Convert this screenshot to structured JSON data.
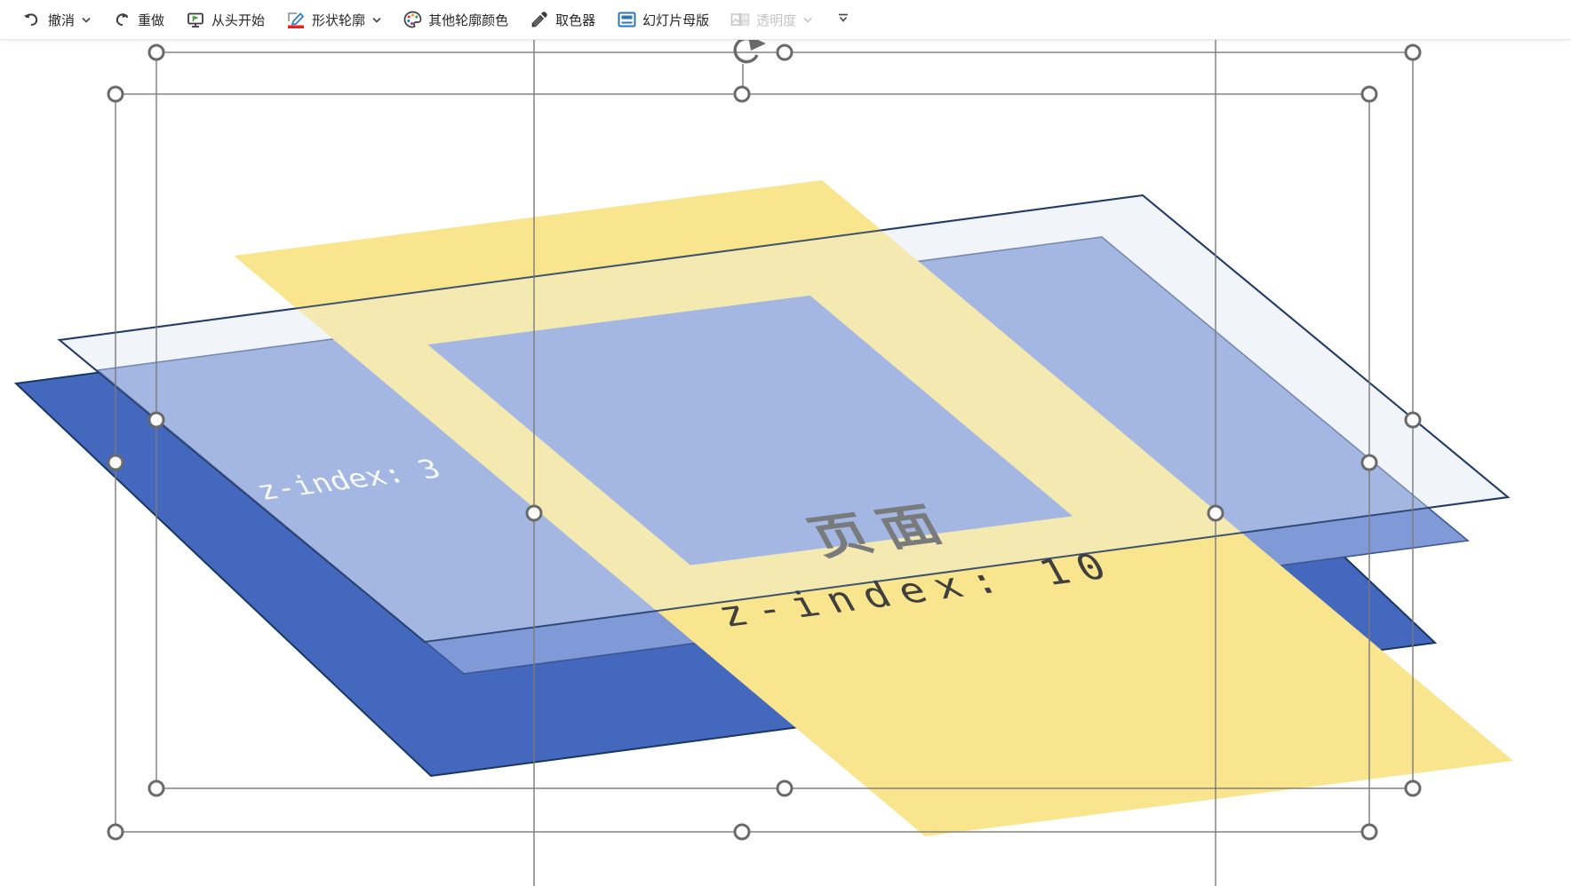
{
  "toolbar": {
    "items": [
      {
        "id": "undo",
        "label": "撤消",
        "dropdown": true
      },
      {
        "id": "redo",
        "label": "重做",
        "dropdown": false
      },
      {
        "id": "start-from-beginning",
        "label": "从头开始",
        "dropdown": false
      },
      {
        "id": "shape-outline",
        "label": "形状轮廓",
        "dropdown": true
      },
      {
        "id": "more-outline-colors",
        "label": "其他轮廓颜色",
        "dropdown": false
      },
      {
        "id": "eyedropper",
        "label": "取色器",
        "dropdown": false
      },
      {
        "id": "slide-master",
        "label": "幻灯片母版",
        "dropdown": false
      },
      {
        "id": "transparency",
        "label": "透明度",
        "dropdown": true,
        "disabled": true
      }
    ]
  },
  "canvas": {
    "labels": {
      "blue_layer": "z-index: 3",
      "page_title": "页面",
      "page_zindex": "z-index: 10"
    },
    "colors": {
      "dark_blue": "#4468be",
      "light_blue": "#809ad8",
      "yellow": "#f8e58e",
      "sheet_fill": "#f3f5f8",
      "sheet_overlay": "rgba(237,243,250,0.33)",
      "outline_navy": "#1f3864",
      "blue_edge": "#3d5590",
      "label_light": "#fdfdfd",
      "label_dark": "#3f3f3f",
      "slide_master_blue": "#2e75b6",
      "outline_swatch_red": "#e8221a",
      "flag_green": "#3f9c35"
    }
  }
}
